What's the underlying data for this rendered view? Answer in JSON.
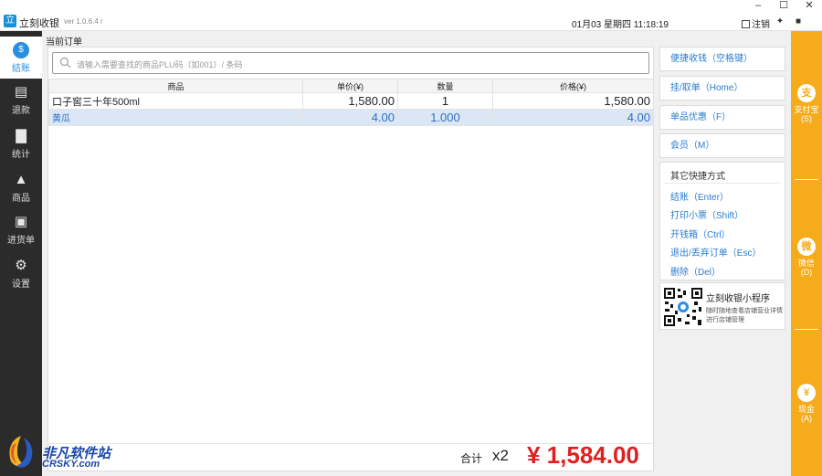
{
  "window": {
    "title": "立刻收银",
    "version": "ver 1.0.6.4 r",
    "datetime": "01月03 星期四 11:18:19",
    "logout_label": "注销",
    "minimize": "–",
    "maximize": "☐",
    "close": "✕"
  },
  "sidebar": {
    "items": [
      {
        "label": "结账",
        "icon": "coin-icon"
      },
      {
        "label": "退款",
        "icon": "clipboard-icon"
      },
      {
        "label": "统计",
        "icon": "bar-chart-icon"
      },
      {
        "label": "商品",
        "icon": "bag-icon"
      },
      {
        "label": "进货单",
        "icon": "basket-icon"
      },
      {
        "label": "设置",
        "icon": "gear-icon"
      }
    ]
  },
  "order": {
    "title": "当前订单",
    "search_placeholder": "请输入需要查找的商品PLU码（如001）/ 条码",
    "columns": [
      "商品",
      "单价(¥)",
      "数量",
      "价格(¥)"
    ],
    "rows": [
      {
        "name": "口子窖三十年500ml",
        "price": "1,580.00",
        "qty": "1",
        "total": "1,580.00"
      },
      {
        "name": "黄瓜",
        "price": "4.00",
        "qty": "1.000",
        "total": "4.00"
      }
    ],
    "total_label": "合计",
    "total_qty": "x2",
    "total_amount": "¥ 1,584.00"
  },
  "shortcuts": {
    "buttons": [
      "便捷收钱（空格键）",
      "挂/取单（Home）",
      "单品优惠（F）",
      "会员（M）"
    ],
    "quick_title": "其它快捷方式",
    "quick_items": [
      "结账（Enter）",
      "打印小票（Shift）",
      "开钱箱（Ctrl）",
      "退出/丢弃订单（Esc）",
      "删除（Del）"
    ],
    "mini_title": "立刻收银小程序",
    "mini_desc": "随时随地查看店铺营业详情进行店铺管理"
  },
  "payments": [
    {
      "label": "支付宝",
      "key": "(S)",
      "glyph": "支"
    },
    {
      "label": "微信",
      "key": "(D)",
      "glyph": "微"
    },
    {
      "label": "现金",
      "key": "(A)",
      "glyph": "¥"
    }
  ],
  "watermark": {
    "cn": "非凡软件站",
    "en": "CRSKY.com"
  },
  "colors": {
    "accent": "#2a8fe0",
    "link": "#2a7ed0",
    "pay_strip": "#f6ab1b",
    "total": "#e02020",
    "sidebar_bg": "#2b2b2b"
  }
}
